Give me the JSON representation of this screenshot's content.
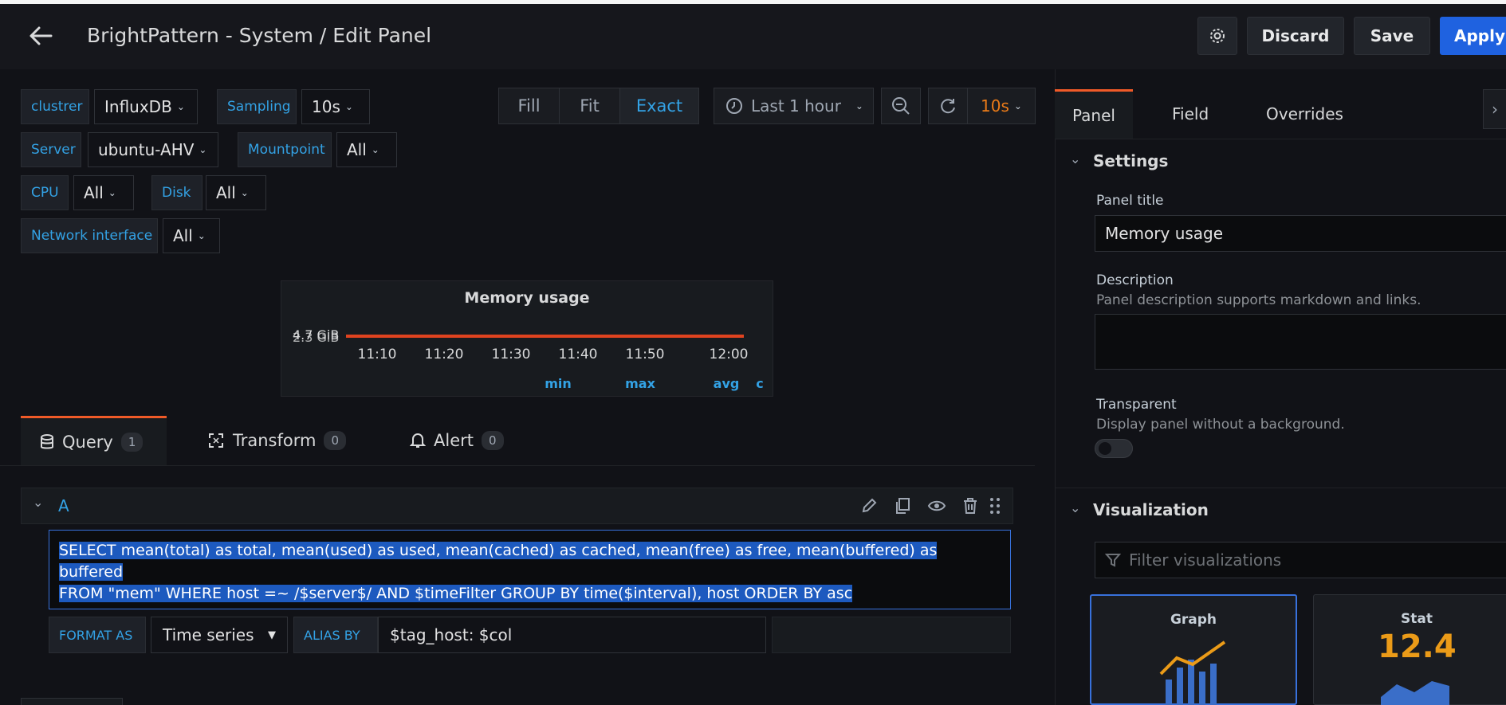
{
  "header": {
    "title": "BrightPattern - System / Edit Panel",
    "discard_label": "Discard",
    "save_label": "Save",
    "apply_label": "Apply"
  },
  "variables": [
    {
      "label": "clustrer",
      "value": "InfluxDB"
    },
    {
      "label": "Sampling",
      "value": "10s"
    },
    {
      "label": "Server",
      "value": "ubuntu-AHV"
    },
    {
      "label": "Mountpoint",
      "value": "All"
    },
    {
      "label": "CPU",
      "value": "All"
    },
    {
      "label": "Disk",
      "value": "All"
    },
    {
      "label": "Network interface",
      "value": "All"
    }
  ],
  "display_modes": [
    "Fill",
    "Fit",
    "Exact"
  ],
  "active_display_mode": "Exact",
  "time_picker": {
    "label": "Last 1 hour"
  },
  "refresh": {
    "interval": "10s"
  },
  "preview": {
    "title": "Memory usage",
    "y_labels_overlap": [
      "4.7 GiB",
      "2.3 GiB"
    ],
    "x_ticks": [
      "11:10",
      "11:20",
      "11:30",
      "11:40",
      "11:50",
      "12:00"
    ],
    "legend_headers": [
      "min",
      "max",
      "avg",
      "c"
    ]
  },
  "query_tabs": [
    {
      "label": "Query",
      "count": "1"
    },
    {
      "label": "Transform",
      "count": "0"
    },
    {
      "label": "Alert",
      "count": "0"
    }
  ],
  "query": {
    "ref_id": "A",
    "sql_line1": "SELECT mean(total) as total, mean(used) as used, mean(cached) as cached, mean(free) as free, mean(buffered) as buffered",
    "sql_line2": "FROM \"mem\" WHERE host =~ /$server$/ AND $timeFilter GROUP BY time($interval), host ORDER BY asc",
    "format_as_label": "FORMAT AS",
    "format_as_value": "Time series",
    "alias_by_label": "ALIAS BY",
    "alias_by_value": "$tag_host: $col"
  },
  "options": {
    "tabs": [
      "Panel",
      "Field",
      "Overrides"
    ],
    "settings_title": "Settings",
    "panel_title_label": "Panel title",
    "panel_title_value": "Memory usage",
    "description_label": "Description",
    "description_hint": "Panel description supports markdown and links.",
    "transparent_label": "Transparent",
    "transparent_hint": "Display panel without a background.",
    "visualization_title": "Visualization",
    "filter_placeholder": "Filter visualizations",
    "viz_cards": [
      {
        "name": "Graph"
      },
      {
        "name": "Stat",
        "sample_value": "12.4"
      }
    ]
  },
  "colors": {
    "accent_blue": "#33a2e5",
    "primary_button": "#1f62e0",
    "active_tab_border": "#f05a28",
    "refresh_orange": "#eb7b18",
    "series_red": "#e0431f"
  }
}
